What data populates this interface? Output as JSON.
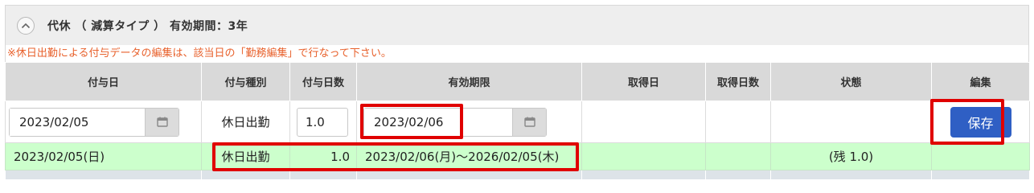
{
  "section": {
    "title": "代休 （ 減算タイプ ） 有効期間：3年"
  },
  "note": "※休日出勤による付与データの編集は、該当日の「勤務編集」で行なって下さい。",
  "table": {
    "headers": [
      "付与日",
      "付与種別",
      "付与日数",
      "有効期限",
      "取得日",
      "取得日数",
      "状態",
      "編集"
    ],
    "edit_row": {
      "grant_date": "2023/02/05",
      "grant_type": "休日出勤",
      "grant_days": "1.0",
      "expiry_date": "2023/02/06",
      "save_label": "保存"
    },
    "data_row": {
      "grant_date": "2023/02/05(日)",
      "grant_type": "休日出勤",
      "grant_days": "1.0",
      "validity": "2023/02/06(月)～2026/02/05(木)",
      "acquired_date": "",
      "acquired_days": "",
      "status": "(残 1.0)"
    }
  },
  "icons": {
    "collapse": "chevron-up-icon",
    "calendar": "calendar-icon"
  },
  "colors": {
    "accent_button": "#2f5fc4",
    "highlight": "#e00000",
    "note_text": "#e8612c",
    "data_row_bg": "#ccffcc"
  }
}
